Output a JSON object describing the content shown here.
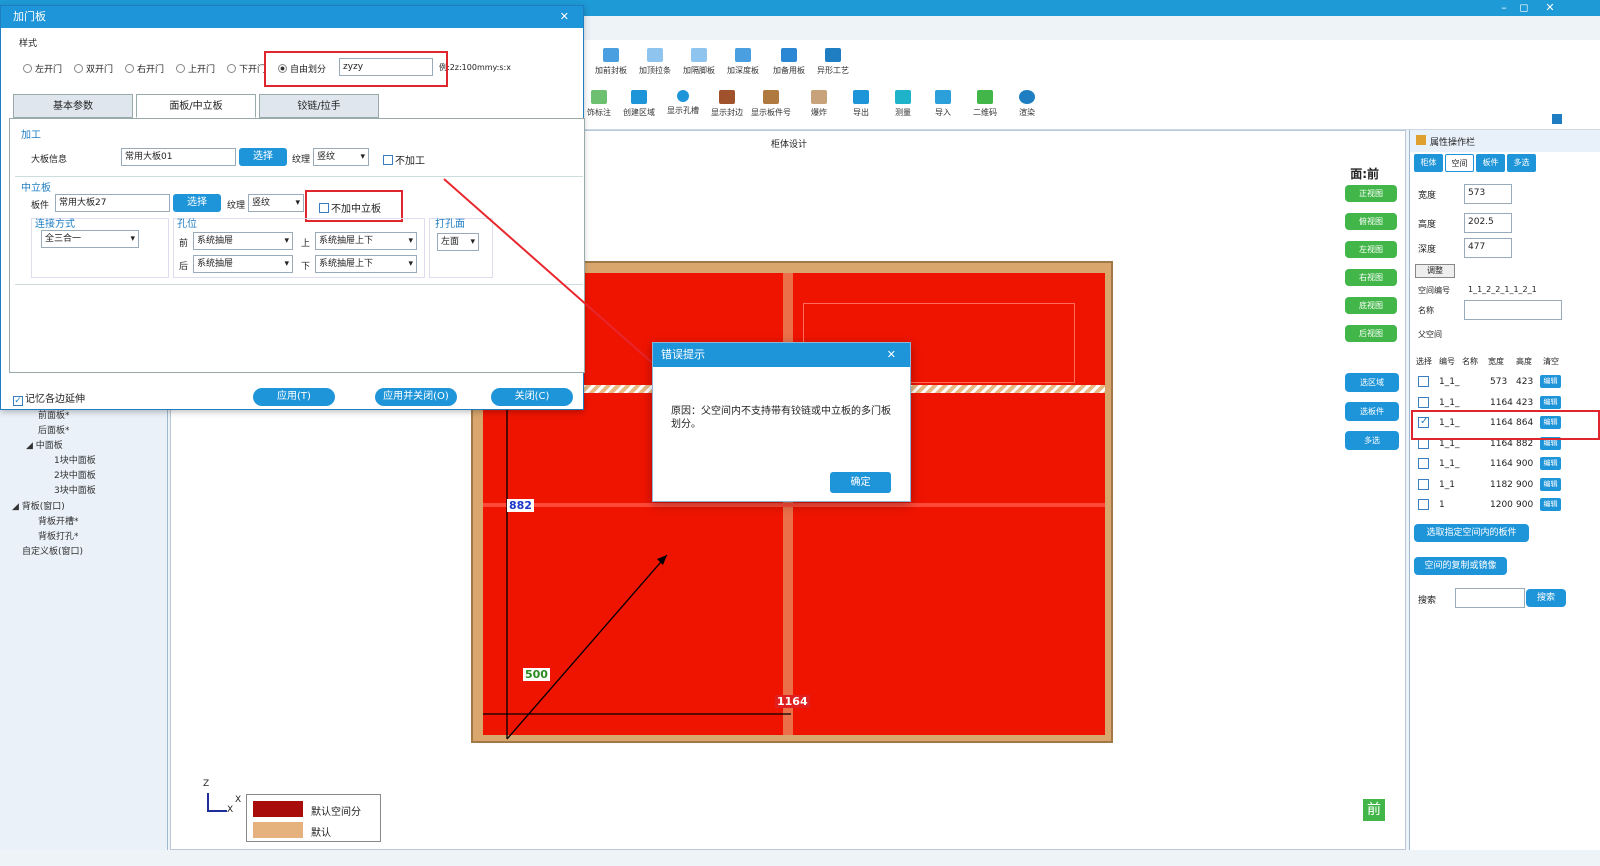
{
  "app": {
    "window_min": "–",
    "window_max": "◻",
    "window_close": "✕"
  },
  "ribbon": {
    "row1": [
      "加前封板",
      "加顶拉条",
      "加隔脚板",
      "加深度板",
      "加备用板",
      "异形工艺"
    ],
    "row2": [
      "饰标注",
      "创建区域",
      "显示孔槽",
      "显示封边",
      "显示板件号",
      "爆炸",
      "导出",
      "测量",
      "导入",
      "二维码",
      "渲染"
    ]
  },
  "tree": {
    "items": [
      "前面板*",
      "后面板*",
      "中面板",
      "1块中面板",
      "2块中面板",
      "3块中面板",
      "背板(窗口)",
      "背板开槽*",
      "背板打孔*",
      "自定义板(窗口)"
    ]
  },
  "canvas": {
    "title": "柜体设计",
    "view_name": "面:前",
    "view_buttons": [
      "正视图",
      "俯视图",
      "左视图",
      "右视图",
      "底视图",
      "后视图"
    ],
    "blue_buttons": [
      "选区域",
      "选板件",
      "多选"
    ],
    "dims": {
      "height": "882",
      "depth": "500",
      "width": "1164"
    },
    "axis": {
      "z": "Z",
      "x": "X",
      "x2": "X"
    },
    "legend": [
      {
        "label": "默认空间分",
        "color": "#a80d0b"
      },
      {
        "label": "默认",
        "color": "#e5b27e"
      }
    ],
    "front_badge": "前"
  },
  "props": {
    "title": "属性操作栏",
    "tabs": [
      "柜体",
      "空间",
      "板件",
      "多选"
    ],
    "width_label": "宽度",
    "width": "573",
    "height_label": "高度",
    "height": "202.5",
    "depth_label": "深度",
    "depth": "477",
    "adjust": "调整",
    "space_no_label": "空间编号",
    "space_no": "1_1_2_2_1_1_2_1",
    "name_label": "名称",
    "name": "",
    "parent_label": "父空间",
    "table_headers": [
      "选择",
      "编号",
      "名称",
      "宽度",
      "高度",
      "清空"
    ],
    "rows": [
      {
        "id": "1_1_",
        "w": "573",
        "h": "423",
        "btn": "编辑",
        "checked": false
      },
      {
        "id": "1_1_",
        "w": "1164",
        "h": "423",
        "btn": "编辑",
        "checked": false
      },
      {
        "id": "1_1_",
        "w": "1164",
        "h": "864",
        "btn": "编辑",
        "checked": true
      },
      {
        "id": "1_1_",
        "w": "1164",
        "h": "882",
        "btn": "编辑",
        "checked": false
      },
      {
        "id": "1_1_",
        "w": "1164",
        "h": "900",
        "btn": "编辑",
        "checked": false
      },
      {
        "id": "1_1",
        "w": "1182",
        "h": "900",
        "btn": "编辑",
        "checked": false
      },
      {
        "id": "1",
        "w": "1200",
        "h": "900",
        "btn": "编辑",
        "checked": false
      }
    ],
    "select_btn": "选取指定空间内的板件",
    "copy_btn": "空间的复制或镜像",
    "search_label": "搜索",
    "search_btn": "搜索"
  },
  "dialog": {
    "title": "加门板",
    "close": "✕",
    "style_label": "样式",
    "radios": [
      "左开门",
      "双开门",
      "右开门",
      "上开门",
      "下开门",
      "自由划分"
    ],
    "free_input": "zyzy",
    "example": "例:2z:100mmy:s:x",
    "tabs": [
      "基本参数",
      "面板/中立板",
      "铰链/拉手"
    ],
    "process": {
      "section": "加工",
      "big_board_label": "大板信息",
      "big_board": "常用大板01",
      "select": "选择",
      "grain_label": "纹理",
      "grain": "竖纹",
      "no_process": "不加工"
    },
    "mid": {
      "section": "中立板",
      "board_label": "板件",
      "board": "常用大板27",
      "select": "选择",
      "grain_label": "纹理",
      "grain": "竖纹",
      "no_mid": "不加中立板",
      "conn_section": "连接方式",
      "conn": "全三合一",
      "hole_section": "孔位",
      "front_label": "前",
      "front": "系统抽屉",
      "back_label": "后",
      "back": "系统抽屉",
      "up_label": "上",
      "up": "系统抽屉上下",
      "down_label": "下",
      "down": "系统抽屉上下",
      "face_section": "打孔面",
      "face": "左面"
    },
    "remember": "记忆各边延伸",
    "apply": "应用(T)",
    "apply_close": "应用并关闭(O)",
    "close_btn": "关闭(C)"
  },
  "error": {
    "title": "错误提示",
    "close": "✕",
    "message": "原因：父空间内不支持带有铰链或中立板的多门板划分。",
    "ok": "确定"
  }
}
